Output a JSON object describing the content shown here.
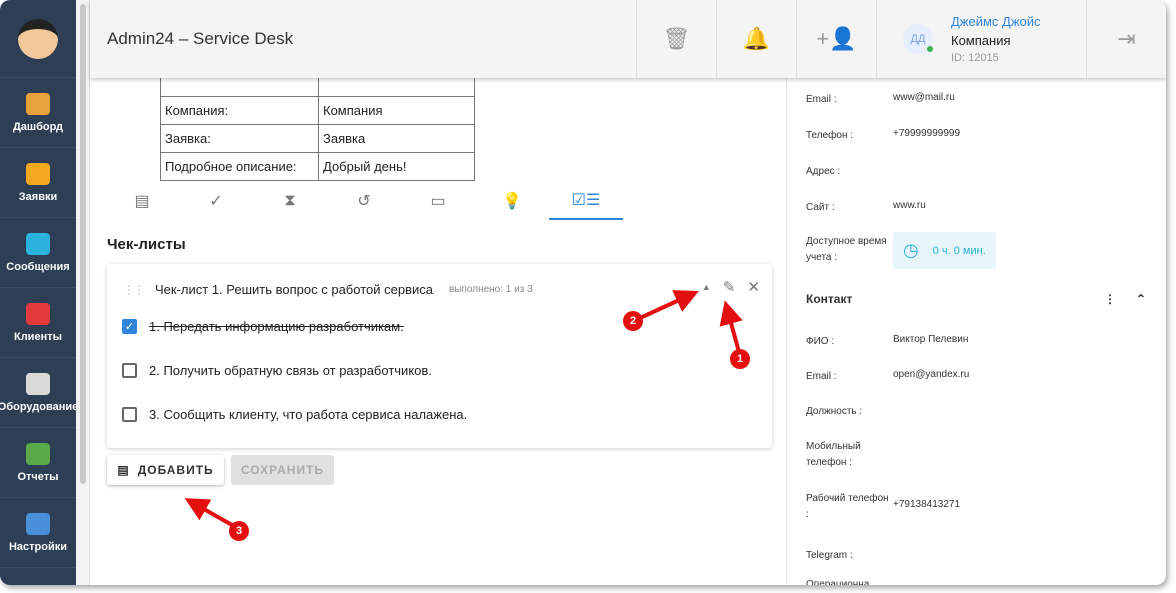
{
  "sidebar": {
    "items": [
      {
        "label": "Дашборд",
        "color": "#e8a23a"
      },
      {
        "label": "Заявки",
        "color": "#f2a81d"
      },
      {
        "label": "Сообщения",
        "color": "#2bb3e0"
      },
      {
        "label": "Клиенты",
        "color": "#e23a3a"
      },
      {
        "label": "Оборудование",
        "color": "#d9d9d9"
      },
      {
        "label": "Отчеты",
        "color": "#5aaa4a"
      },
      {
        "label": "Настройки",
        "color": "#4a90d9"
      }
    ]
  },
  "header": {
    "title": "Admin24 – Service Desk",
    "user": {
      "initials": "ДД",
      "name": "Джеймс Джойс",
      "company": "Компания",
      "id": "ID: 12015"
    }
  },
  "info_table": [
    [
      "Компания:",
      "Компания"
    ],
    [
      "Заявка:",
      "Заявка"
    ],
    [
      "Подробное описание:",
      "Добрый день!"
    ]
  ],
  "section_title": "Чек-листы",
  "checklist": {
    "title": "Чек-лист 1. Решить вопрос с работой сервиса",
    "progress": "выполнено: 1 из 3",
    "items": [
      {
        "text": "1.  Передать информацию разработчикам.",
        "done": true
      },
      {
        "text": "2.  Получить обратную связь от разработчиков.",
        "done": false
      },
      {
        "text": "3.  Сообщить клиенту, что работа сервиса налажена.",
        "done": false
      }
    ]
  },
  "buttons": {
    "add": "ДОБАВИТЬ",
    "save": "СОХРАНИТЬ"
  },
  "company_info": [
    {
      "k": "Email :",
      "v": "www@mail.ru"
    },
    {
      "k": "Телефон :",
      "v": "+79999999999"
    },
    {
      "k": "Адрес :",
      "v": ""
    },
    {
      "k": "Сайт :",
      "v": "www.ru"
    }
  ],
  "time": {
    "label": "Доступное время учета :",
    "value": "0 ч. 0 мин."
  },
  "contact": {
    "title": "Контакт",
    "rows": [
      {
        "k": "ФИО :",
        "v": "Виктор Пелевин"
      },
      {
        "k": "Email :",
        "v": "open@yandex.ru"
      },
      {
        "k": "Должность :",
        "v": ""
      },
      {
        "k": "Мобильный телефон :",
        "v": ""
      },
      {
        "k": "Рабочий телефон :",
        "v": "+79138413271"
      },
      {
        "k": "Telegram :",
        "v": ""
      },
      {
        "k": "Операционна",
        "v": ""
      }
    ]
  },
  "annotations": [
    "1",
    "2",
    "3"
  ]
}
